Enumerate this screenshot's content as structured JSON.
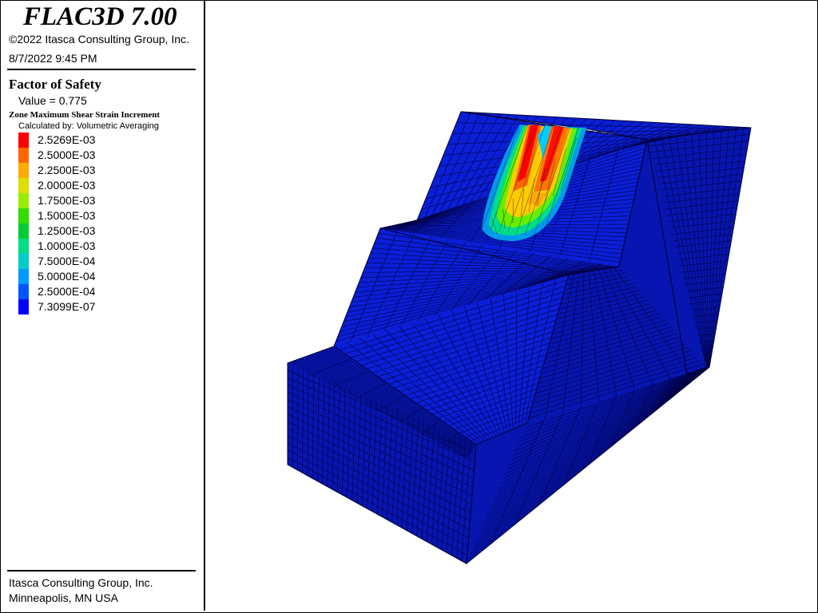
{
  "header": {
    "title": "FLAC3D 7.00",
    "copyright": "©2022 Itasca Consulting Group, Inc.",
    "datetime": "8/7/2022 9:45 PM"
  },
  "plot": {
    "fos_title": "Factor of Safety",
    "fos_value": "Value = 0.775",
    "contour_title": "Zone Maximum Shear Strain Increment",
    "calc_method": "Calculated by: Volumetric Averaging"
  },
  "legend": [
    {
      "label": "2.5269E-03",
      "color": "#ff0000"
    },
    {
      "label": "2.5000E-03",
      "color": "#ff6600"
    },
    {
      "label": "2.2500E-03",
      "color": "#ffaa00"
    },
    {
      "label": "2.0000E-03",
      "color": "#dddd00"
    },
    {
      "label": "1.7500E-03",
      "color": "#99ee00"
    },
    {
      "label": "1.5000E-03",
      "color": "#33dd00"
    },
    {
      "label": "1.2500E-03",
      "color": "#00cc33"
    },
    {
      "label": "1.0000E-03",
      "color": "#00dd88"
    },
    {
      "label": "7.5000E-04",
      "color": "#00cccc"
    },
    {
      "label": "5.0000E-04",
      "color": "#0099ff"
    },
    {
      "label": "2.5000E-04",
      "color": "#0055ff"
    },
    {
      "label": "7.3099E-07",
      "color": "#0000ff"
    }
  ],
  "footer": {
    "line1": "Itasca Consulting Group, Inc.",
    "line2": "Minneapolis, MN  USA"
  },
  "colors": {
    "mesh_fill": "#0a1fd6",
    "mesh_fill_dark": "#0716b0",
    "mesh_line": "#000040"
  }
}
